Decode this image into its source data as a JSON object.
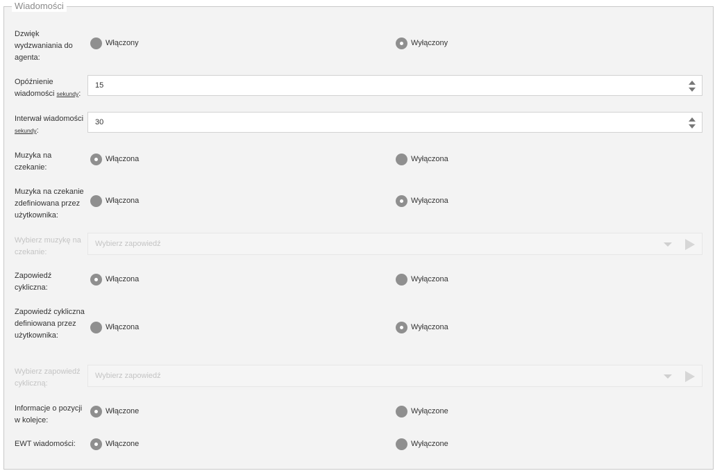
{
  "legend": "Wiadomości",
  "ring_sound": {
    "label": "Dzwięk wydzwaniania do agenta:",
    "on": "Włączony",
    "off": "Wyłączony",
    "selected": "off"
  },
  "message_delay": {
    "label": "Opóźnienie wiadomości",
    "unit": "sekundy",
    "suffix": ":",
    "value": "15"
  },
  "message_interval": {
    "label": "Interwał wiadomości",
    "unit": "sekundy",
    "suffix": ":",
    "value": "30"
  },
  "hold_music": {
    "label": "Muzyka na czekanie:",
    "on": "Włączona",
    "off": "Wyłączona",
    "selected": "on"
  },
  "user_hold_music": {
    "label": "Muzyka na czekanie zdefiniowana przez użytkownika:",
    "on": "Włączona",
    "off": "Wyłączona",
    "selected": "off"
  },
  "select_hold_music": {
    "label": "Wybierz muzykę na czekanie:",
    "placeholder": "Wybierz zapowiedź"
  },
  "cyclic_announcement": {
    "label": "Zapowiedź cykliczna:",
    "on": "Włączona",
    "off": "Wyłączona",
    "selected": "on"
  },
  "user_cyclic_announcement": {
    "label": "Zapowiedź cykliczna definiowana przez użytkownika:",
    "on": "Włączona",
    "off": "Wyłączona",
    "selected": "off"
  },
  "select_cyclic_announcement": {
    "label": "Wybierz zapowiedź cykliczną:",
    "placeholder": "Wybierz zapowiedź"
  },
  "queue_position": {
    "label": "Informacje o pozycji w kolejce:",
    "on": "Włączone",
    "off": "Wyłączone",
    "selected": "on"
  },
  "ewt_messages": {
    "label": "EWT wiadomości:",
    "on": "Włączone",
    "off": "Wyłączone",
    "selected": "on"
  },
  "colors": {
    "radio": "#8f8f8f",
    "panel_bg": "#f3f3f3",
    "border": "#c8c8c8",
    "disabled_text": "#c4c4c4"
  }
}
